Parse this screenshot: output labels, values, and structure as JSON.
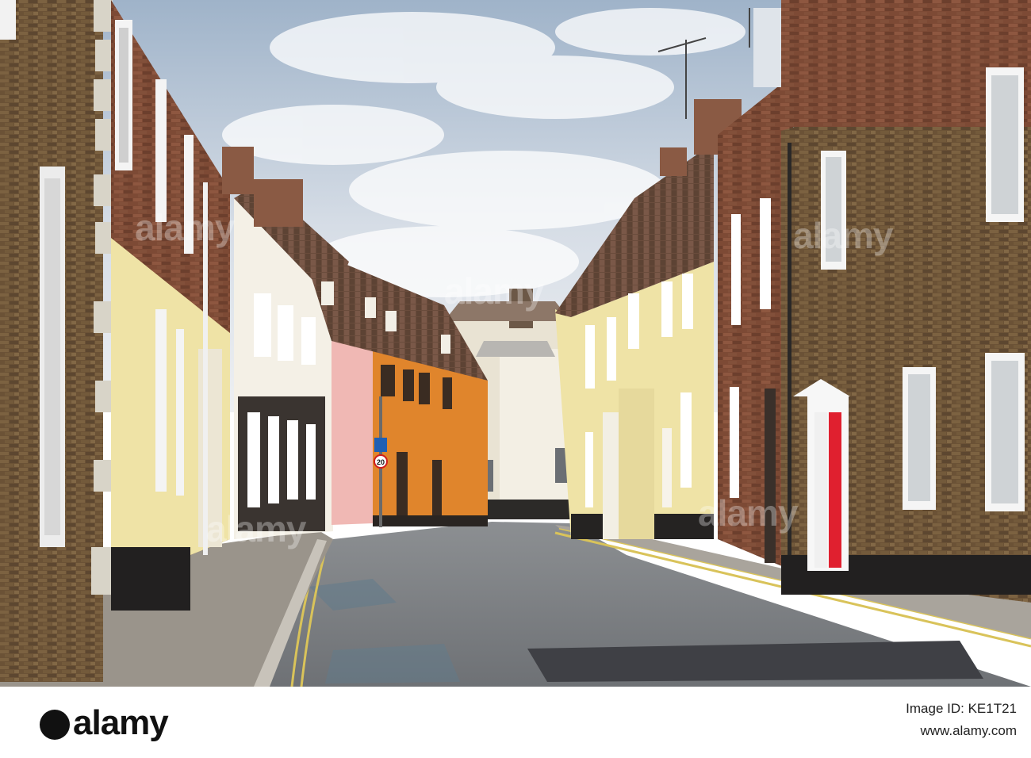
{
  "footer": {
    "brand": "alamy",
    "site": "www.alamy.com",
    "image_id": "Image ID: KE1T21"
  },
  "watermark": {
    "text": "alamy"
  },
  "sign": {
    "speed_limit": "20"
  },
  "colors": {
    "sky": "#c9d6e3",
    "brick_dark": "#5f4a35",
    "brick_red": "#7a4a33",
    "cream_wall": "#efe3a6",
    "orange_house": "#e0852c",
    "pink_house": "#f0b8b4",
    "red_door": "#e0202f",
    "road": "#777b80",
    "yellow_line": "#d9c35a"
  }
}
